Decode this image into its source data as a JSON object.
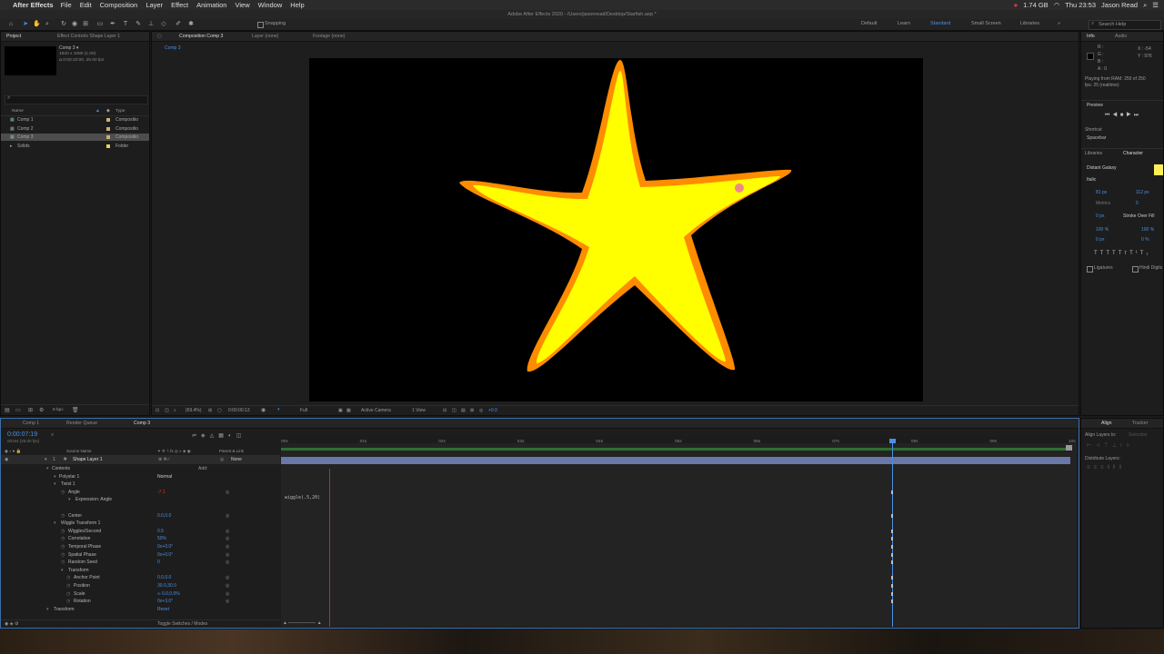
{
  "menubar": {
    "app_name": "After Effects",
    "menus": [
      "File",
      "Edit",
      "Composition",
      "Layer",
      "Effect",
      "Animation",
      "View",
      "Window",
      "Help"
    ],
    "battery": "1.74 GB",
    "clock": "Thu 23:53",
    "user": "Jason Read"
  },
  "window_title": "Adobe After Effects 2020 - /Users/jasonread/Desktop/Starfish.aep *",
  "toolbar": {
    "snapping_label": "Snapping",
    "workspaces": [
      "Default",
      "Learn",
      "Standard",
      "Small Screen",
      "Libraries"
    ],
    "active_workspace": "Standard",
    "search_placeholder": "Search Help"
  },
  "project_panel": {
    "tabs": [
      "Project",
      "Effect Controls Shape Layer 1"
    ],
    "comp_name": "Comp 3 ▾",
    "comp_info_1": "1920 x 1080 (1.00)",
    "comp_info_2": "Δ 0:00:10:00, 25.00 fps",
    "col_name": "Name",
    "col_type": "Type",
    "items": [
      {
        "name": "Comp 1",
        "type": "Compositio",
        "color": "#c9b26e",
        "selected": false
      },
      {
        "name": "Comp 2",
        "type": "Compositio",
        "color": "#c9b26e",
        "selected": false
      },
      {
        "name": "Comp 3",
        "type": "Compositio",
        "color": "#c9b26e",
        "selected": true
      },
      {
        "name": "Solids",
        "type": "Folder",
        "color": "#e6d35a",
        "selected": false
      }
    ],
    "bpc": "8 bpc"
  },
  "viewer": {
    "tabs": [
      "Composition Comp 3",
      "Layer (none)",
      "Footage (none)"
    ],
    "breadcrumb": "Comp 3",
    "zoom": "(69.4%)",
    "timecode": "0:00:00:13",
    "resolution": "Full",
    "camera": "Active Camera",
    "views": "1 View",
    "exposure": "+0.0",
    "star_fill": "#ffff00",
    "star_stroke": "#ff8c00"
  },
  "right_panel": {
    "tabs": [
      "Info",
      "Audio"
    ],
    "info_r": "R :",
    "info_g": "G :",
    "info_b": "B :",
    "info_a": "A : 0",
    "info_x": "X : -54",
    "info_y": "Y : 976",
    "playing_1": "Playing from RAM: 250 of 250",
    "playing_2": "fps: 25 (realtime)",
    "preview_title": "Preview",
    "shortcut_label": "Shortcut",
    "shortcut_value": "Spacebar",
    "char_tabs": [
      "Libraries",
      "Character"
    ],
    "font_name": "Distant Galaxy",
    "font_style": "Italic",
    "font_size": "81 px",
    "leading": "112 px",
    "metrics": "Metrics",
    "tracking": "0",
    "stroke_width": "0 px",
    "stroke_mode": "Stroke Over Fill",
    "vscale": "100 %",
    "hscale": "100 %",
    "baseline": "0 px",
    "tsume": "0 %",
    "ligatures": "Ligatures",
    "hindi": "Hindi Digits",
    "color_swatch": "#ffef5a"
  },
  "timeline": {
    "tabs": [
      "Comp 1",
      "Render Queue",
      "Comp 3"
    ],
    "timecode": "0:00:07:19",
    "frame_info": "00194 (25.00 fps)",
    "col_source": "Source Name",
    "col_parent": "Parent & Link",
    "layer_name": "Shape Layer 1",
    "layer_index": "1",
    "parent_value": "None",
    "ruler": [
      "00s",
      "01s",
      "02s",
      "03s",
      "04s",
      "05s",
      "06s",
      "07s",
      "08s",
      "09s",
      "10s"
    ],
    "expression_text": "wiggle(.5,20)",
    "toggle_label": "Toggle Switches / Modes",
    "rows": [
      {
        "label": "Contents",
        "indent": 1,
        "value": "",
        "add": "Add:"
      },
      {
        "label": "Polystar 1",
        "indent": 2,
        "value": "Normal"
      },
      {
        "label": "Twist 1",
        "indent": 2,
        "value": ""
      },
      {
        "label": "Angle",
        "indent": 3,
        "value": "-7.1",
        "stopwatch": true
      },
      {
        "label": "Expression: Angle",
        "indent": 4,
        "value": ""
      },
      {
        "label": "",
        "indent": 0,
        "value": ""
      },
      {
        "label": "Center",
        "indent": 3,
        "value": "0.0,0.0",
        "stopwatch": true
      },
      {
        "label": "Wiggle Transform 1",
        "indent": 2,
        "value": ""
      },
      {
        "label": "Wiggles/Second",
        "indent": 3,
        "value": "0.5",
        "stopwatch": true
      },
      {
        "label": "Correlation",
        "indent": 3,
        "value": "50%",
        "stopwatch": true
      },
      {
        "label": "Temporal Phase",
        "indent": 3,
        "value": "0x+0.0°",
        "stopwatch": true
      },
      {
        "label": "Spatial Phase",
        "indent": 3,
        "value": "0x+0.0°",
        "stopwatch": true
      },
      {
        "label": "Random Seed",
        "indent": 3,
        "value": "0",
        "stopwatch": true
      },
      {
        "label": "Transform",
        "indent": 3,
        "value": ""
      },
      {
        "label": "Anchor Point",
        "indent": 4,
        "value": "0.0,0.0",
        "stopwatch": true
      },
      {
        "label": "Position",
        "indent": 4,
        "value": "30.0,30.0",
        "stopwatch": true
      },
      {
        "label": "Scale",
        "indent": 4,
        "value": "∞ 0.0,0.0%",
        "stopwatch": true
      },
      {
        "label": "Rotation",
        "indent": 4,
        "value": "0x+3.0°",
        "stopwatch": true
      },
      {
        "label": "Transform",
        "indent": 1,
        "value": "Reset"
      }
    ]
  },
  "align_panel": {
    "tabs": [
      "Align",
      "Tracker"
    ],
    "align_layers_to": "Align Layers to:",
    "selection": "Selection",
    "distribute": "Distribute Layers:"
  }
}
